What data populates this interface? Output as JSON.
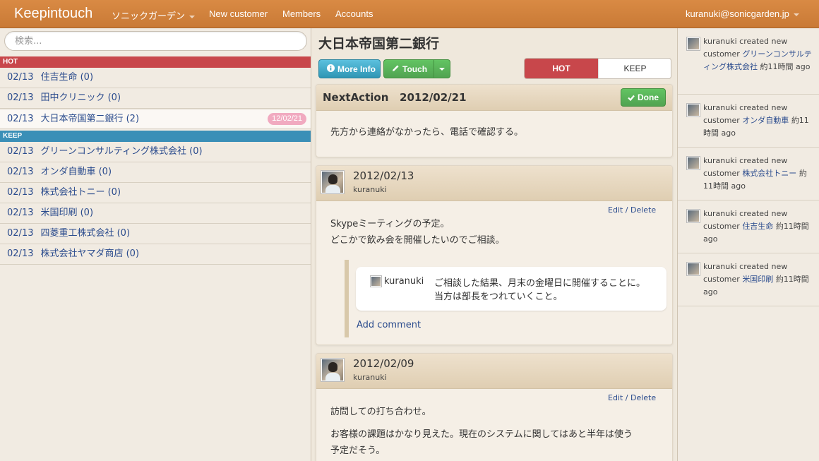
{
  "app": {
    "brand": "Keepintouch"
  },
  "nav": {
    "group": "ソニックガーデン",
    "new_customer": "New customer",
    "members": "Members",
    "accounts": "Accounts",
    "user": "kuranuki@sonicgarden.jp"
  },
  "colors": {
    "nav": "#cf8139",
    "hot": "#c8474b",
    "keep": "#3a8fb7",
    "link": "#2a4b8d"
  },
  "sidebar": {
    "search_placeholder": "検索...",
    "hot_label": "HOT",
    "keep_label": "KEEP",
    "hot_items": [
      {
        "date": "02/13",
        "name": "住吉生命 (0)"
      },
      {
        "date": "02/13",
        "name": "田中クリニック (0)"
      },
      {
        "date": "02/13",
        "name": "大日本帝国第二銀行 (2)",
        "badge": "12/02/21",
        "selected": true
      }
    ],
    "keep_items": [
      {
        "date": "02/13",
        "name": "グリーンコンサルティング株式会社 (0)"
      },
      {
        "date": "02/13",
        "name": "オンダ自動車 (0)"
      },
      {
        "date": "02/13",
        "name": "株式会社トニー (0)"
      },
      {
        "date": "02/13",
        "name": "米国印刷 (0)"
      },
      {
        "date": "02/13",
        "name": "四菱重工株式会社 (0)"
      },
      {
        "date": "02/13",
        "name": "株式会社ヤマダ商店 (0)"
      }
    ]
  },
  "main": {
    "title": "大日本帝国第二銀行",
    "more_info": "More Info",
    "touch": "Touch",
    "toggle": {
      "hot": "HOT",
      "keep": "KEEP",
      "selected": "HOT"
    },
    "next_action": {
      "label": "NextAction",
      "date": "2012/02/21",
      "done": "Done",
      "text": "先方から連絡がなかったら、電話で確認する。"
    },
    "entries": [
      {
        "date": "2012/02/13",
        "user": "kuranuki",
        "edit": "Edit / Delete",
        "lines": [
          "Skypeミーティングの予定。",
          "どこかで飲み会を開催したいのでご相談。"
        ],
        "comment": {
          "user": "kuranuki",
          "lines": [
            "ご相談した結果、月末の金曜日に開催することに。",
            "当方は部長をつれていくこと。"
          ]
        },
        "add_comment": "Add comment"
      },
      {
        "date": "2012/02/09",
        "user": "kuranuki",
        "edit": "Edit / Delete",
        "lines": [
          "訪問しての打ち合わせ。",
          "お客様の課題はかなり見えた。現在のシステムに関してはあと半年は使う",
          "予定だそう。"
        ]
      }
    ]
  },
  "activity": [
    {
      "user": "kuranuki",
      "action": "created new customer",
      "target": "グリーンコンサルティング株式会社",
      "time": "約11時間 ago"
    },
    {
      "user": "kuranuki",
      "action": "created new customer",
      "target": "オンダ自動車",
      "time": "約11時間 ago"
    },
    {
      "user": "kuranuki",
      "action": "created new customer",
      "target": "株式会社トニー",
      "time": "約11時間 ago"
    },
    {
      "user": "kuranuki",
      "action": "created new customer",
      "target": "住吉生命",
      "time": "約11時間 ago"
    },
    {
      "user": "kuranuki",
      "action": "created new customer",
      "target": "米国印刷",
      "time": "約11時間 ago"
    }
  ]
}
